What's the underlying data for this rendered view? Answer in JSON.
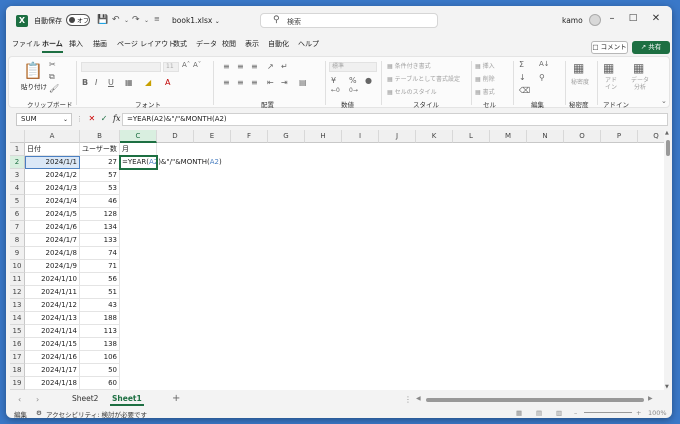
{
  "titlebar": {
    "app_icon": "X",
    "autosave_label": "自動保存",
    "autosave_state": "オフ",
    "filename": "book1.xlsx",
    "search_placeholder": "検索",
    "user": "kamo"
  },
  "menu": {
    "tabs": [
      "ファイル",
      "ホーム",
      "挿入",
      "描画",
      "ページ レイアウト",
      "数式",
      "データ",
      "校閲",
      "表示",
      "自動化",
      "ヘルプ"
    ],
    "active": "ホーム",
    "comment_label": "コメント",
    "share_label": "共有"
  },
  "ribbon": {
    "paste_label": "貼り付け",
    "font_size": "11",
    "number_format": "標準",
    "conditional_format": "条件付き書式",
    "table_format": "テーブルとして書式設定",
    "cell_styles": "セルのスタイル",
    "insert": "挿入",
    "delete": "削除",
    "format": "書式",
    "sensitivity": "秘密度",
    "addins": "アド イン",
    "data_analysis": "データ 分析",
    "groups": {
      "clipboard": "クリップボード",
      "font": "フォント",
      "alignment": "配置",
      "number": "数値",
      "styles": "スタイル",
      "cells": "セル",
      "editing": "編集",
      "sensitivity": "秘密度",
      "addins": "アドイン"
    }
  },
  "formula_bar": {
    "name_box": "SUM",
    "fx": "fx",
    "formula": "=YEAR(A2)&\"/\"&MONTH(A2)"
  },
  "grid": {
    "columns": [
      "A",
      "B",
      "C",
      "D",
      "E",
      "F",
      "G",
      "H",
      "I",
      "J",
      "K",
      "L",
      "M",
      "N",
      "O",
      "P",
      "Q"
    ],
    "selected_column": "C",
    "headers": {
      "A": "日付",
      "B": "ユーザー数",
      "C": "月"
    },
    "rows": [
      {
        "n": "2",
        "a": "2024/1/1",
        "b": "27"
      },
      {
        "n": "3",
        "a": "2024/1/2",
        "b": "57"
      },
      {
        "n": "4",
        "a": "2024/1/3",
        "b": "53"
      },
      {
        "n": "5",
        "a": "2024/1/4",
        "b": "46"
      },
      {
        "n": "6",
        "a": "2024/1/5",
        "b": "128"
      },
      {
        "n": "7",
        "a": "2024/1/6",
        "b": "134"
      },
      {
        "n": "8",
        "a": "2024/1/7",
        "b": "133"
      },
      {
        "n": "9",
        "a": "2024/1/8",
        "b": "74"
      },
      {
        "n": "10",
        "a": "2024/1/9",
        "b": "71"
      },
      {
        "n": "11",
        "a": "2024/1/10",
        "b": "56"
      },
      {
        "n": "12",
        "a": "2024/1/11",
        "b": "51"
      },
      {
        "n": "13",
        "a": "2024/1/12",
        "b": "43"
      },
      {
        "n": "14",
        "a": "2024/1/13",
        "b": "188"
      },
      {
        "n": "15",
        "a": "2024/1/14",
        "b": "113"
      },
      {
        "n": "16",
        "a": "2024/1/15",
        "b": "138"
      },
      {
        "n": "17",
        "a": "2024/1/16",
        "b": "106"
      },
      {
        "n": "18",
        "a": "2024/1/17",
        "b": "50"
      },
      {
        "n": "19",
        "a": "2024/1/18",
        "b": "60"
      }
    ],
    "editing_cell": {
      "part1": "=YEAR(",
      "ref1": "A2",
      "part2": ")&\"/\"&MONTH(",
      "ref2": "A2",
      "part3": ")"
    }
  },
  "sheets": {
    "tabs": [
      "Sheet2",
      "Sheet1"
    ],
    "active": "Sheet1"
  },
  "status": {
    "mode": "編集",
    "accessibility": "アクセシビリティ: 検討が必要です",
    "zoom": "100%"
  }
}
